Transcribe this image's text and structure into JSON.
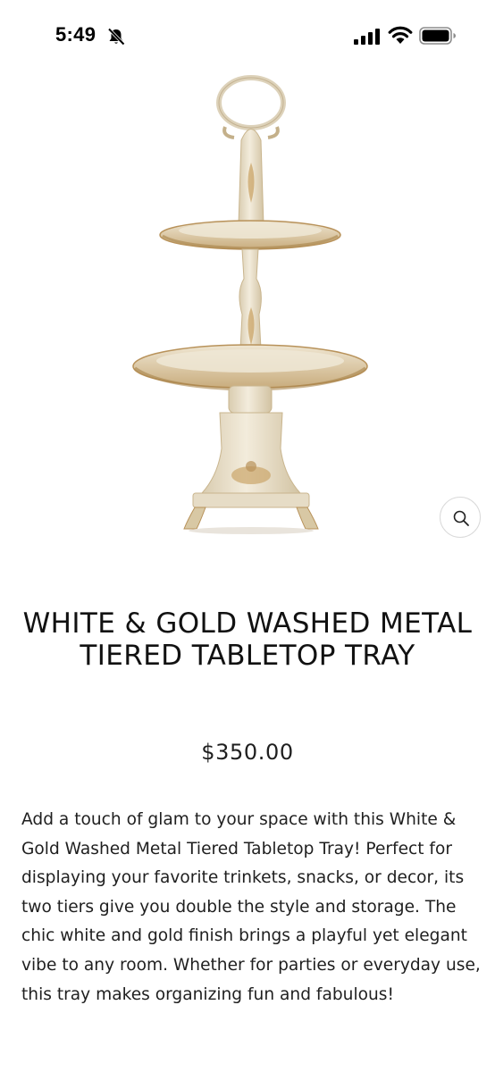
{
  "status_bar": {
    "time": "5:49",
    "icons": [
      "bell-slash-icon",
      "cellular-signal-icon",
      "wifi-icon",
      "battery-icon"
    ]
  },
  "product": {
    "image_alt": "White and gold washed metal two-tier tabletop tray",
    "zoom_icon": "search-icon",
    "title": "WHITE & GOLD WASHED METAL TIERED TABLETOP TRAY",
    "price": "$350.00",
    "description": "Add a touch of glam to your space with this White & Gold Washed Metal Tiered Tabletop Tray! Perfect for displaying your favorite trinkets, snacks, or decor, its two tiers give you double the style and storage. The chic white and gold finish brings a playful yet elegant vibe to any room. Whether for parties or everyday use, this tray makes organizing fun and fabulous!"
  },
  "colors": {
    "background": "#ffffff",
    "text": "#1a1a1a",
    "tray_cream": "#ece3cf",
    "tray_gold": "#b8925a"
  }
}
